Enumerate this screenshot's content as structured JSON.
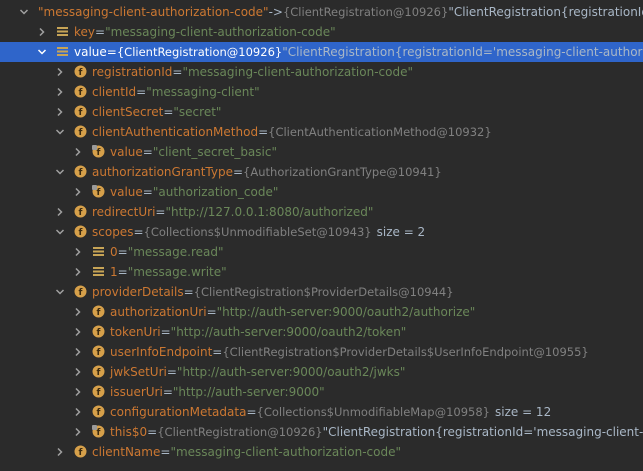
{
  "rows": [
    {
      "depth": 0,
      "arrow": "down",
      "icon": "",
      "name": "\"messaging-client-authorization-code\"",
      "eq": " -> ",
      "value": "",
      "type": "{ClientRegistration@10926}",
      "extra": " \"ClientRegistration{registrationId='messaging-cl",
      "size": ""
    },
    {
      "depth": 1,
      "arrow": "right",
      "icon": "field",
      "name": "key",
      "eq": " = ",
      "value": "\"messaging-client-authorization-code\"",
      "type": "",
      "extra": "",
      "size": ""
    },
    {
      "depth": 1,
      "arrow": "down",
      "icon": "field",
      "name": "value",
      "eq": " = ",
      "value": "",
      "type": "{ClientRegistration@10926}",
      "extra": " \"ClientRegistration{registrationId='messaging-client-authorization",
      "size": "",
      "selected": true
    },
    {
      "depth": 2,
      "arrow": "right",
      "icon": "f",
      "name": "registrationId",
      "eq": " = ",
      "value": "\"messaging-client-authorization-code\"",
      "type": "",
      "extra": "",
      "size": ""
    },
    {
      "depth": 2,
      "arrow": "right",
      "icon": "f",
      "name": "clientId",
      "eq": " = ",
      "value": "\"messaging-client\"",
      "type": "",
      "extra": "",
      "size": ""
    },
    {
      "depth": 2,
      "arrow": "right",
      "icon": "f",
      "name": "clientSecret",
      "eq": " = ",
      "value": "\"secret\"",
      "type": "",
      "extra": "",
      "size": ""
    },
    {
      "depth": 2,
      "arrow": "down",
      "icon": "f",
      "name": "clientAuthenticationMethod",
      "eq": " = ",
      "value": "",
      "type": "{ClientAuthenticationMethod@10932}",
      "extra": "",
      "size": ""
    },
    {
      "depth": 3,
      "arrow": "right",
      "icon": "f-lock",
      "name": "value",
      "eq": " = ",
      "value": "\"client_secret_basic\"",
      "type": "",
      "extra": "",
      "size": ""
    },
    {
      "depth": 2,
      "arrow": "down",
      "icon": "f",
      "name": "authorizationGrantType",
      "eq": " = ",
      "value": "",
      "type": "{AuthorizationGrantType@10941}",
      "extra": "",
      "size": ""
    },
    {
      "depth": 3,
      "arrow": "right",
      "icon": "f-lock",
      "name": "value",
      "eq": " = ",
      "value": "\"authorization_code\"",
      "type": "",
      "extra": "",
      "size": ""
    },
    {
      "depth": 2,
      "arrow": "right",
      "icon": "f",
      "name": "redirectUri",
      "eq": " = ",
      "value": "\"http://127.0.0.1:8080/authorized\"",
      "type": "",
      "extra": "",
      "size": ""
    },
    {
      "depth": 2,
      "arrow": "down",
      "icon": "f",
      "name": "scopes",
      "eq": " = ",
      "value": "",
      "type": "{Collections$UnmodifiableSet@10943}",
      "extra": "",
      "size": "size = 2"
    },
    {
      "depth": 3,
      "arrow": "right",
      "icon": "field",
      "name": "0",
      "eq": " = ",
      "value": "\"message.read\"",
      "type": "",
      "extra": "",
      "size": ""
    },
    {
      "depth": 3,
      "arrow": "right",
      "icon": "field",
      "name": "1",
      "eq": " = ",
      "value": "\"message.write\"",
      "type": "",
      "extra": "",
      "size": ""
    },
    {
      "depth": 2,
      "arrow": "down",
      "icon": "f",
      "name": "providerDetails",
      "eq": " = ",
      "value": "",
      "type": "{ClientRegistration$ProviderDetails@10944}",
      "extra": "",
      "size": ""
    },
    {
      "depth": 3,
      "arrow": "right",
      "icon": "f",
      "name": "authorizationUri",
      "eq": " = ",
      "value": "\"http://auth-server:9000/oauth2/authorize\"",
      "type": "",
      "extra": "",
      "size": ""
    },
    {
      "depth": 3,
      "arrow": "right",
      "icon": "f",
      "name": "tokenUri",
      "eq": " = ",
      "value": "\"http://auth-server:9000/oauth2/token\"",
      "type": "",
      "extra": "",
      "size": ""
    },
    {
      "depth": 3,
      "arrow": "right",
      "icon": "f",
      "name": "userInfoEndpoint",
      "eq": " = ",
      "value": "",
      "type": "{ClientRegistration$ProviderDetails$UserInfoEndpoint@10955}",
      "extra": "",
      "size": ""
    },
    {
      "depth": 3,
      "arrow": "right",
      "icon": "f",
      "name": "jwkSetUri",
      "eq": " = ",
      "value": "\"http://auth-server:9000/oauth2/jwks\"",
      "type": "",
      "extra": "",
      "size": ""
    },
    {
      "depth": 3,
      "arrow": "right",
      "icon": "f",
      "name": "issuerUri",
      "eq": " = ",
      "value": "\"http://auth-server:9000\"",
      "type": "",
      "extra": "",
      "size": ""
    },
    {
      "depth": 3,
      "arrow": "right",
      "icon": "f",
      "name": "configurationMetadata",
      "eq": " = ",
      "value": "",
      "type": "{Collections$UnmodifiableMap@10958}",
      "extra": "",
      "size": "size = 12"
    },
    {
      "depth": 3,
      "arrow": "right",
      "icon": "f-lock",
      "name": "this$0",
      "eq": " = ",
      "value": "",
      "type": "{ClientRegistration@10926}",
      "extra": " \"ClientRegistration{registrationId='messaging-client-autho",
      "size": ""
    },
    {
      "depth": 2,
      "arrow": "right",
      "icon": "f",
      "name": "clientName",
      "eq": " = ",
      "value": "\"messaging-client-authorization-code\"",
      "type": "",
      "extra": "",
      "size": ""
    }
  ]
}
